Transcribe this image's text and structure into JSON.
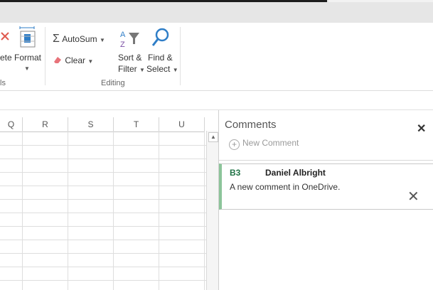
{
  "ribbon": {
    "delete_partial": "ete",
    "format_label": "Format",
    "cells_group_partial": "ls",
    "autosum_label": "AutoSum",
    "clear_label": "Clear",
    "sort_label_1": "Sort &",
    "sort_label_2": "Filter",
    "find_label_1": "Find &",
    "find_label_2": "Select",
    "editing_group": "Editing"
  },
  "columns": [
    "Q",
    "R",
    "S",
    "T",
    "U"
  ],
  "comments_pane": {
    "title": "Comments",
    "new_comment": "New Comment",
    "comments": [
      {
        "cell": "B3",
        "author": "Daniel Albright",
        "text": "A new comment in OneDrive."
      }
    ]
  },
  "colors": {
    "accent": "#217346",
    "card_border": "#8cc49a",
    "icon_blue": "#2f7ec7",
    "icon_red": "#e05a4f"
  }
}
